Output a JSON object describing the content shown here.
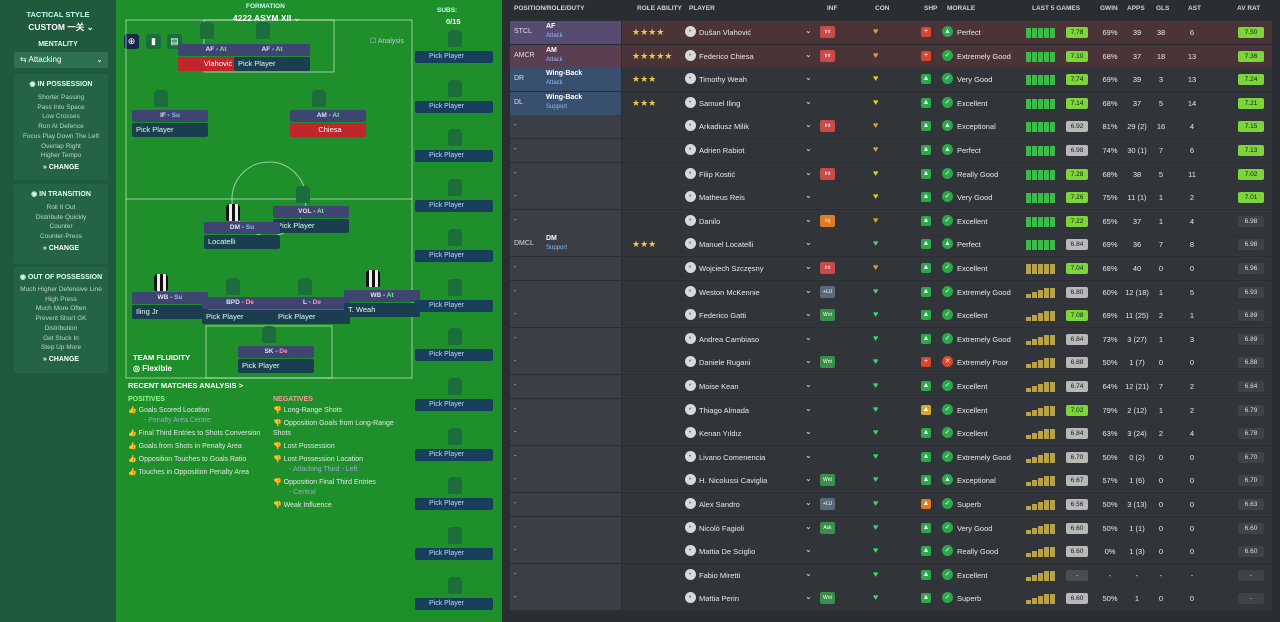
{
  "left_panel": {
    "tactical_style_label": "TACTICAL STYLE",
    "tactical_style_value": "CUSTOM 一关",
    "mentality_label": "MENTALITY",
    "mentality_value": "Attacking",
    "in_possession": {
      "title": "IN POSSESSION",
      "items": [
        "Shorter Passing",
        "Pass Into Space",
        "Low Crosses",
        "Run At Defence",
        "Focus Play Down The Left",
        "Overlap Right",
        "Higher Tempo"
      ],
      "change": "CHANGE"
    },
    "in_transition": {
      "title": "IN TRANSITION",
      "items": [
        "Roll It Out",
        "Distribute Quickly",
        "Counter",
        "Counter-Press"
      ],
      "change": "CHANGE"
    },
    "out_of_possession": {
      "title": "OUT OF POSSESSION",
      "items": [
        "Much Higher Defensive Line",
        "High Press",
        "Much More Often",
        "Prevent Short GK",
        "Distribution",
        "Get Stuck In",
        "Step Up More"
      ],
      "change": "CHANGE"
    }
  },
  "pitch": {
    "formation_label": "FORMATION",
    "formation_value": "4222 ASYM XII",
    "subs_label": "SUBS:",
    "subs_value": "0/15",
    "analysis_label": "Analysis",
    "team_fluidity_label": "TEAM FLUIDITY",
    "team_fluidity_value": "Flexible",
    "slots": [
      {
        "role": "AF",
        "duty": "At",
        "name": "Vlahović",
        "red": true
      },
      {
        "role": "AF",
        "duty": "At",
        "name": "Pick Player",
        "red": false
      },
      {
        "role": "IF",
        "duty": "Su",
        "name": "Pick Player",
        "red": false
      },
      {
        "role": "AM",
        "duty": "At",
        "name": "Chiesa",
        "red": true
      },
      {
        "role": "VOL",
        "duty": "At",
        "name": "Pick Player",
        "red": false
      },
      {
        "role": "DM",
        "duty": "Su",
        "name": "Locatelli",
        "red": false
      },
      {
        "role": "WB",
        "duty": "Su",
        "name": "Iling Jr",
        "red": false
      },
      {
        "role": "BPD",
        "duty": "De",
        "name": "Pick Player",
        "red": false
      },
      {
        "role": "L",
        "duty": "De",
        "name": "Pick Player",
        "red": false
      },
      {
        "role": "WB",
        "duty": "At",
        "name": "T. Weah",
        "red": false
      },
      {
        "role": "SK",
        "duty": "De",
        "name": "Pick Player",
        "red": false
      }
    ],
    "shirt_numbers": [
      "3",
      "17",
      "22"
    ],
    "sub_label": "Pick Player"
  },
  "analysis": {
    "title": "RECENT MATCHES ANALYSIS >",
    "positives_label": "POSITIVES",
    "negatives_label": "NEGATIVES",
    "positives": [
      "Goals Scored Location",
      "- Penalty Area Centre",
      "Final Third Entries to Shots Conversion",
      "Goals from Shots in Penalty Area",
      "Opposition Touches to Goals Ratio",
      "Touches in Opposition Penalty Area"
    ],
    "negatives": [
      "Long-Range Shots",
      "Opposition Goals from Long-Range Shots",
      "Lost Possession",
      "Lost Possession Location",
      "- Attacking Third - Left",
      "Opposition Final Third Entries",
      "- Central",
      "Weak Influence"
    ]
  },
  "table": {
    "headers": [
      "POSITION/ROLE/DUTY",
      "ROLE ABILITY",
      "PLAYER",
      "INF",
      "CON",
      "SHP",
      "MORALE",
      "LAST 5 GAMES",
      "GWIN",
      "APPS",
      "GLS",
      "AST",
      "AV RAT"
    ],
    "rows": [
      {
        "pos": "STCL",
        "role": "AF",
        "duty": "Attack",
        "stars": "★★★★",
        "player": "Dušan Vlahović",
        "inf": "Int",
        "morale": "Perfect",
        "rating": "7.78",
        "gwin": "69%",
        "apps": "39",
        "gls": "38",
        "ast": "6",
        "avrat": "7.50"
      },
      {
        "pos": "AMCR",
        "role": "AM",
        "duty": "Attack",
        "stars": "★★★★★",
        "player": "Federico Chiesa",
        "inf": "Int",
        "morale": "Extremely Good",
        "rating": "7.10",
        "gwin": "68%",
        "apps": "37",
        "gls": "18",
        "ast": "13",
        "avrat": "7.36"
      },
      {
        "pos": "DR",
        "role": "Wing-Back",
        "duty": "Attack",
        "stars": "★★★",
        "player": "Timothy Weah",
        "inf": "",
        "morale": "Very Good",
        "rating": "7.74",
        "gwin": "69%",
        "apps": "39",
        "gls": "3",
        "ast": "13",
        "avrat": "7.24"
      },
      {
        "pos": "DL",
        "role": "Wing-Back",
        "duty": "Support",
        "stars": "★★★",
        "player": "Samuel Iling",
        "inf": "",
        "morale": "Excellent",
        "rating": "7.14",
        "gwin": "68%",
        "apps": "37",
        "gls": "5",
        "ast": "14",
        "avrat": "7.21"
      },
      {
        "pos": "-",
        "role": "",
        "duty": "",
        "stars": "",
        "player": "Arkadiusz Milik",
        "inf": "Int",
        "morale": "Exceptional",
        "rating": "6.92",
        "gwin": "81%",
        "apps": "29 (2)",
        "gls": "16",
        "ast": "4",
        "avrat": "7.15"
      },
      {
        "pos": "-",
        "role": "",
        "duty": "",
        "stars": "",
        "player": "Adrien Rabiot",
        "inf": "",
        "morale": "Perfect",
        "rating": "6.98",
        "gwin": "74%",
        "apps": "30 (1)",
        "gls": "7",
        "ast": "6",
        "avrat": "7.13"
      },
      {
        "pos": "-",
        "role": "",
        "duty": "",
        "stars": "",
        "player": "Filip Kostić",
        "inf": "Int",
        "morale": "Really Good",
        "rating": "7.28",
        "gwin": "68%",
        "apps": "38",
        "gls": "5",
        "ast": "11",
        "avrat": "7.02"
      },
      {
        "pos": "-",
        "role": "",
        "duty": "",
        "stars": "",
        "player": "Matheus Reis",
        "inf": "",
        "morale": "Very Good",
        "rating": "7.26",
        "gwin": "75%",
        "apps": "11 (1)",
        "gls": "1",
        "ast": "2",
        "avrat": "7.01"
      },
      {
        "pos": "-",
        "role": "",
        "duty": "",
        "stars": "",
        "player": "Danilo",
        "inf": "Inj",
        "morale": "Excellent",
        "rating": "7.22",
        "gwin": "65%",
        "apps": "37",
        "gls": "1",
        "ast": "4",
        "avrat": "6.98"
      },
      {
        "pos": "DMCL",
        "role": "DM",
        "duty": "Support",
        "stars": "★★★",
        "player": "Manuel Locatelli",
        "inf": "",
        "morale": "Perfect",
        "rating": "6.84",
        "gwin": "69%",
        "apps": "36",
        "gls": "7",
        "ast": "8",
        "avrat": "6.98"
      },
      {
        "pos": "-",
        "role": "",
        "duty": "",
        "stars": "",
        "player": "Wojciech Szczęsny",
        "inf": "Int",
        "morale": "Excellent",
        "rating": "7.04",
        "gwin": "68%",
        "apps": "40",
        "gls": "0",
        "ast": "0",
        "avrat": "6.96"
      },
      {
        "pos": "-",
        "role": "",
        "duty": "",
        "stars": "",
        "player": "Weston McKennie",
        "inf": "+LU",
        "morale": "Extremely Good",
        "rating": "6.80",
        "gwin": "60%",
        "apps": "12 (18)",
        "gls": "1",
        "ast": "5",
        "avrat": "6.93"
      },
      {
        "pos": "-",
        "role": "",
        "duty": "",
        "stars": "",
        "player": "Federico Gatti",
        "inf": "Wnt",
        "morale": "Excellent",
        "rating": "7.08",
        "gwin": "69%",
        "apps": "11 (25)",
        "gls": "2",
        "ast": "1",
        "avrat": "6.89"
      },
      {
        "pos": "-",
        "role": "",
        "duty": "",
        "stars": "",
        "player": "Andrea Cambiaso",
        "inf": "",
        "morale": "Extremely Good",
        "rating": "6.84",
        "gwin": "73%",
        "apps": "3 (27)",
        "gls": "1",
        "ast": "3",
        "avrat": "6.89"
      },
      {
        "pos": "-",
        "role": "",
        "duty": "",
        "stars": "",
        "player": "Daniele Rugani",
        "inf": "Wnt",
        "morale": "Extremely Poor",
        "rating": "6.88",
        "gwin": "50%",
        "apps": "1 (7)",
        "gls": "0",
        "ast": "0",
        "avrat": "6.88"
      },
      {
        "pos": "-",
        "role": "",
        "duty": "",
        "stars": "",
        "player": "Moise Kean",
        "inf": "",
        "morale": "Excellent",
        "rating": "6.74",
        "gwin": "64%",
        "apps": "12 (21)",
        "gls": "7",
        "ast": "2",
        "avrat": "6.84"
      },
      {
        "pos": "-",
        "role": "",
        "duty": "",
        "stars": "",
        "player": "Thiago Almada",
        "inf": "",
        "morale": "Excellent",
        "rating": "7.02",
        "gwin": "79%",
        "apps": "2 (12)",
        "gls": "1",
        "ast": "2",
        "avrat": "6.79"
      },
      {
        "pos": "-",
        "role": "",
        "duty": "",
        "stars": "",
        "player": "Kenan Yıldız",
        "inf": "",
        "morale": "Excellent",
        "rating": "6.84",
        "gwin": "63%",
        "apps": "3 (24)",
        "gls": "2",
        "ast": "4",
        "avrat": "6.78"
      },
      {
        "pos": "-",
        "role": "",
        "duty": "",
        "stars": "",
        "player": "Livano Comenencia",
        "inf": "",
        "morale": "Extremely Good",
        "rating": "6.70",
        "gwin": "50%",
        "apps": "0 (2)",
        "gls": "0",
        "ast": "0",
        "avrat": "6.70"
      },
      {
        "pos": "-",
        "role": "",
        "duty": "",
        "stars": "",
        "player": "H. Nicolussi Caviglia",
        "inf": "Wnt",
        "morale": "Exceptional",
        "rating": "6.67",
        "gwin": "57%",
        "apps": "1 (6)",
        "gls": "0",
        "ast": "0",
        "avrat": "6.70"
      },
      {
        "pos": "-",
        "role": "",
        "duty": "",
        "stars": "",
        "player": "Alex Sandro",
        "inf": "+LU",
        "morale": "Superb",
        "rating": "6.56",
        "gwin": "50%",
        "apps": "3 (13)",
        "gls": "0",
        "ast": "0",
        "avrat": "6.63"
      },
      {
        "pos": "-",
        "role": "",
        "duty": "",
        "stars": "",
        "player": "Nicolò Fagioli",
        "inf": "Ask",
        "morale": "Very Good",
        "rating": "6.60",
        "gwin": "50%",
        "apps": "1 (1)",
        "gls": "0",
        "ast": "0",
        "avrat": "6.60"
      },
      {
        "pos": "-",
        "role": "",
        "duty": "",
        "stars": "",
        "player": "Mattia De Sciglio",
        "inf": "",
        "morale": "Really Good",
        "rating": "6.60",
        "gwin": "0%",
        "apps": "1 (3)",
        "gls": "0",
        "ast": "0",
        "avrat": "6.60"
      },
      {
        "pos": "-",
        "role": "",
        "duty": "",
        "stars": "",
        "player": "Fabio Miretti",
        "inf": "",
        "morale": "Excellent",
        "rating": "-",
        "gwin": "-",
        "apps": "-",
        "gls": "-",
        "ast": "-",
        "avrat": "-"
      },
      {
        "pos": "-",
        "role": "",
        "duty": "",
        "stars": "",
        "player": "Mattia Perin",
        "inf": "Wnt",
        "morale": "Superb",
        "rating": "6.60",
        "gwin": "50%",
        "apps": "1",
        "gls": "0",
        "ast": "0",
        "avrat": "-"
      }
    ]
  }
}
